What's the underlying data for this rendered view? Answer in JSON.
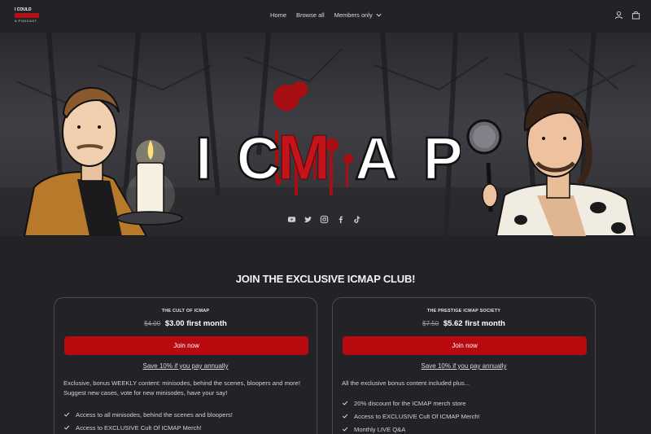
{
  "header": {
    "logo": {
      "line1": "I COULD",
      "line2": "MURDER",
      "line3": "A PODCAST"
    },
    "nav": [
      {
        "label": "Home"
      },
      {
        "label": "Browse all"
      },
      {
        "label": "Members only"
      }
    ],
    "icons": [
      "user-icon",
      "bag-icon"
    ]
  },
  "hero": {
    "title_left": "IC",
    "title_mid": "M",
    "title_right": "AP",
    "socials": [
      "youtube-icon",
      "twitter-icon",
      "instagram-icon",
      "facebook-icon",
      "tiktok-icon"
    ]
  },
  "section": {
    "heading": "JOIN THE EXCLUSIVE ICMAP CLUB!"
  },
  "plans": [
    {
      "name": "THE CULT OF ICMAP",
      "old_price": "$4.00",
      "new_price": "$3.00 first month",
      "join_label": "Join now",
      "save_label": "Save 10% if you pay annually",
      "description": "Exclusive, bonus WEEKLY content: minisodes, behind the scenes, bloopers and more! Suggest new cases, vote for new minisodes, have your say!",
      "features": [
        "Access to all minisodes, behind the scenes and bloopers!",
        "Access to EXCLUSIVE Cult Of ICMAP Merch!"
      ]
    },
    {
      "name": "THE PRESTIGE ICMAP SOCIETY",
      "old_price": "$7.50",
      "new_price": "$5.62 first month",
      "join_label": "Join now",
      "save_label": "Save 10% if you pay annually",
      "description": "All the exclusive bonus content included plus...",
      "features": [
        "20% discount for the ICMAP merch store",
        "Access to EXCLUSIVE Cult Of ICMAP Merch!",
        "Monthly LIVE Q&A"
      ]
    }
  ],
  "colors": {
    "background": "#232327",
    "accent_red": "#b8090f",
    "card_border": "#4a4a50"
  }
}
